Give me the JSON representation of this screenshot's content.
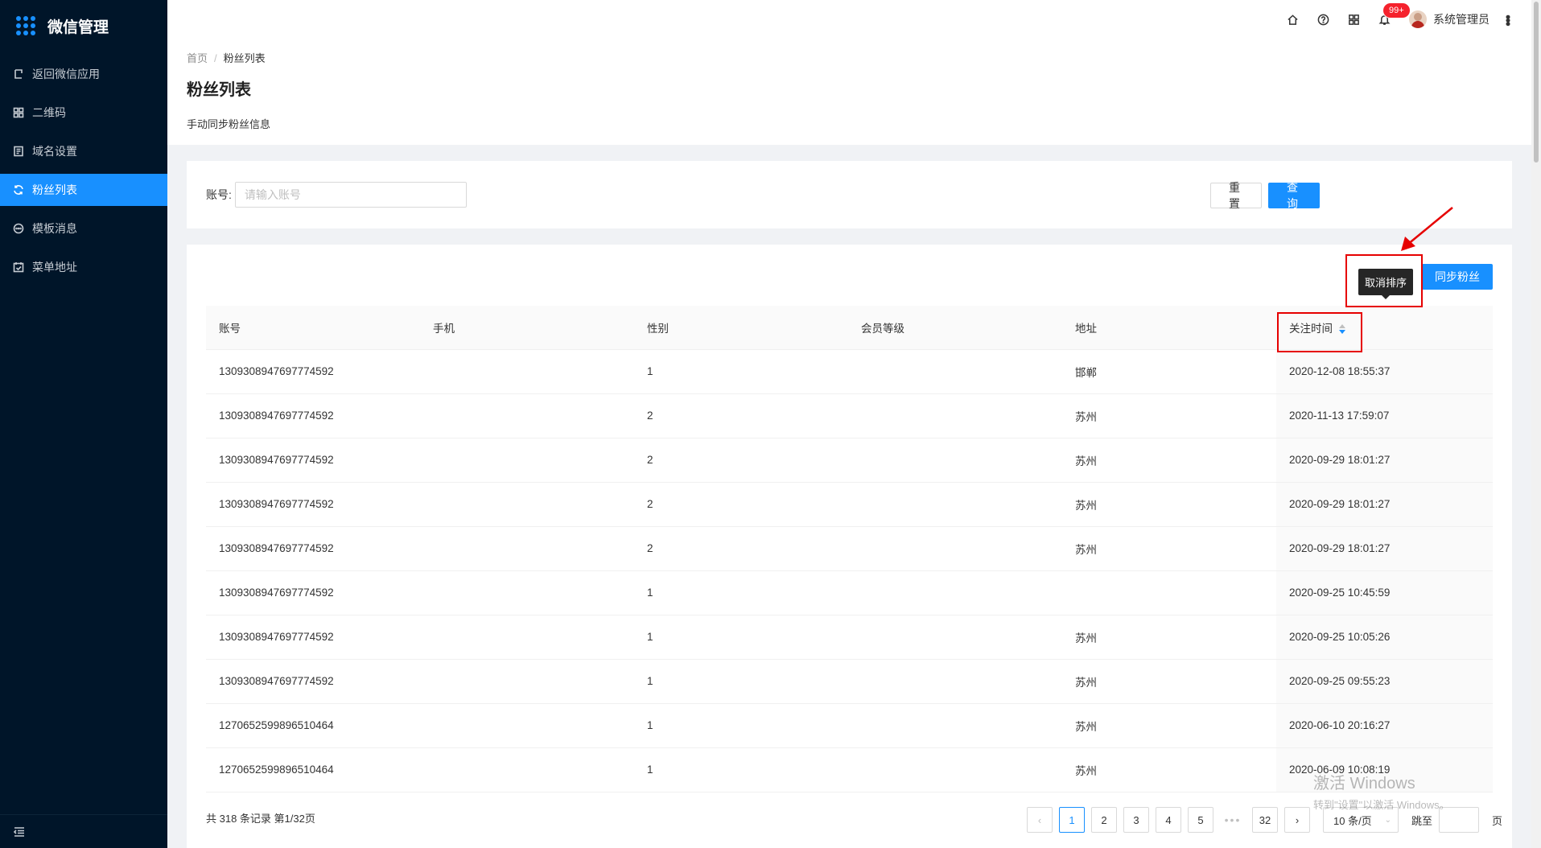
{
  "app": {
    "title": "微信管理"
  },
  "sidebar": {
    "items": [
      {
        "label": "返回微信应用",
        "icon": "return-icon",
        "active": false
      },
      {
        "label": "二维码",
        "icon": "qrcode-icon",
        "active": false
      },
      {
        "label": "域名设置",
        "icon": "document-icon",
        "active": false
      },
      {
        "label": "粉丝列表",
        "icon": "sync-icon",
        "active": true
      },
      {
        "label": "模板消息",
        "icon": "message-icon",
        "active": false
      },
      {
        "label": "菜单地址",
        "icon": "calendar-check-icon",
        "active": false
      }
    ],
    "collapse_icon": "menu-fold-icon"
  },
  "header": {
    "notification_badge": "99+",
    "username": "系统管理员"
  },
  "breadcrumb": {
    "home": "首页",
    "current": "粉丝列表"
  },
  "page": {
    "title": "粉丝列表",
    "description": "手动同步粉丝信息"
  },
  "filter": {
    "account_label": "账号:",
    "account_placeholder": "请输入账号",
    "reset_label": "重置",
    "query_label": "查询"
  },
  "toolbar": {
    "sync_label": "同步粉丝",
    "tooltip": "取消排序"
  },
  "table": {
    "columns": [
      "账号",
      "手机",
      "性别",
      "会员等级",
      "地址",
      "关注时间"
    ],
    "sorted_column": "关注时间",
    "rows": [
      [
        "1309308947697774592",
        "",
        "1",
        "",
        "邯郸",
        "2020-12-08 18:55:37"
      ],
      [
        "1309308947697774592",
        "",
        "2",
        "",
        "苏州",
        "2020-11-13 17:59:07"
      ],
      [
        "1309308947697774592",
        "",
        "2",
        "",
        "苏州",
        "2020-09-29 18:01:27"
      ],
      [
        "1309308947697774592",
        "",
        "2",
        "",
        "苏州",
        "2020-09-29 18:01:27"
      ],
      [
        "1309308947697774592",
        "",
        "2",
        "",
        "苏州",
        "2020-09-29 18:01:27"
      ],
      [
        "1309308947697774592",
        "",
        "1",
        "",
        "",
        "2020-09-25 10:45:59"
      ],
      [
        "1309308947697774592",
        "",
        "1",
        "",
        "苏州",
        "2020-09-25 10:05:26"
      ],
      [
        "1309308947697774592",
        "",
        "1",
        "",
        "苏州",
        "2020-09-25 09:55:23"
      ],
      [
        "1270652599896510464",
        "",
        "1",
        "",
        "苏州",
        "2020-06-10 20:16:27"
      ],
      [
        "1270652599896510464",
        "",
        "1",
        "",
        "苏州",
        "2020-06-09 10:08:19"
      ]
    ]
  },
  "pagination": {
    "total_text": "共 318 条记录 第1/32页",
    "pages": [
      "1",
      "2",
      "3",
      "4",
      "5"
    ],
    "last_page": "32",
    "current": "1",
    "page_size": "10 条/页",
    "jump_label": "跳至",
    "jump_suffix": "页"
  },
  "watermark": {
    "line1": "激活 Windows",
    "line2": "转到\"设置\"以激活 Windows。"
  },
  "colors": {
    "sidebar_bg": "#001529",
    "primary": "#1890ff",
    "highlight": "#e60000",
    "badge": "#f5222d"
  }
}
